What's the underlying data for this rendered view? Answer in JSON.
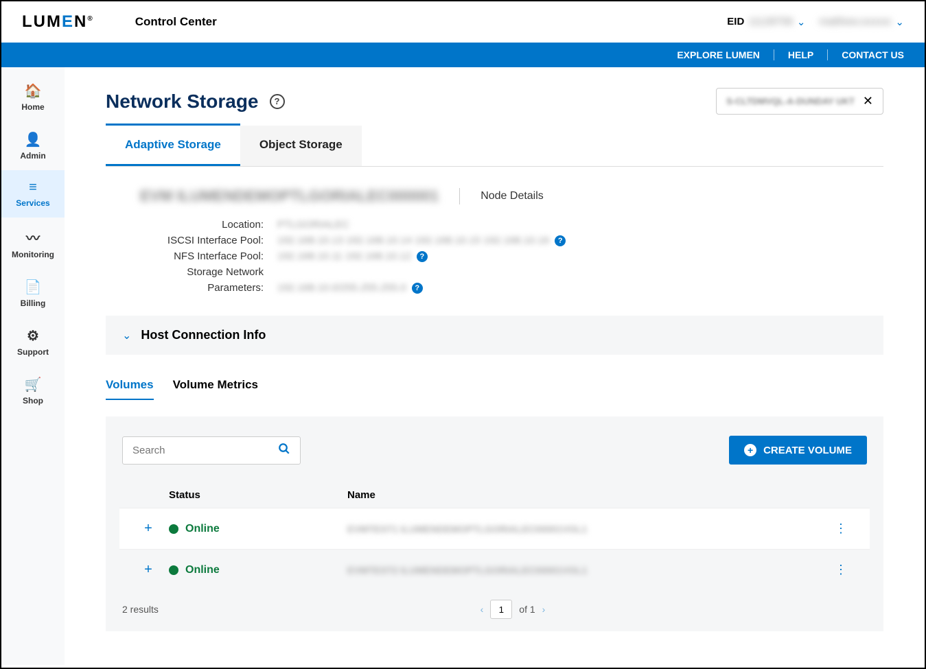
{
  "header": {
    "brand_prefix": "LUM",
    "brand_e": "E",
    "brand_suffix": "N",
    "reg": "®",
    "product": "Control Center",
    "eid_label": "EID",
    "eid_value": "11128758",
    "user_name": "matthew.xxxxxx"
  },
  "bluebar": {
    "explore": "EXPLORE LUMEN",
    "help": "HELP",
    "contact": "CONTACT US"
  },
  "sidebar": [
    {
      "icon": "🏠",
      "label": "Home"
    },
    {
      "icon": "👤",
      "label": "Admin"
    },
    {
      "icon": "☰",
      "label": "Services",
      "active": true
    },
    {
      "icon": "〰",
      "label": "Monitoring"
    },
    {
      "icon": "📄",
      "label": "Billing"
    },
    {
      "icon": "⚙",
      "label": "Support"
    },
    {
      "icon": "🛒",
      "label": "Shop"
    }
  ],
  "page": {
    "title": "Network Storage",
    "context_value": "S-CLTDMVQL-A-DUNDAY UKT"
  },
  "tabs": [
    {
      "label": "Adaptive Storage",
      "active": true
    },
    {
      "label": "Object Storage"
    }
  ],
  "node": {
    "name": "EVM ILUMENDEMOPTLGORIALEC000001",
    "details_link": "Node Details",
    "fields": {
      "location_label": "Location:",
      "location_value": "PTLGORIALEC",
      "iscsi_label": "ISCSI Interface Pool:",
      "iscsi_value": "192.168.10.13  192.168.10.14  192.168.10.15  192.168.10.16",
      "nfs_label": "NFS Interface Pool:",
      "nfs_value": "192.168.10.11  192.168.10.12",
      "storage_label_1": "Storage Network",
      "storage_label_2": "Parameters:",
      "storage_value": "192.168.10.0/255.255.255.0"
    }
  },
  "expand_panel": {
    "title": "Host Connection Info"
  },
  "inner_tabs": [
    {
      "label": "Volumes",
      "active": true
    },
    {
      "label": "Volume Metrics"
    }
  ],
  "volumes": {
    "search_placeholder": "Search",
    "create_label": "CREATE VOLUME",
    "col_status": "Status",
    "col_name": "Name",
    "rows": [
      {
        "status": "Online",
        "name": "EVMTEST1 ILUMENDEMOPTLGORIALEC00001VOL1"
      },
      {
        "status": "Online",
        "name": "EVMTEST2 ILUMENDEMOPTLGORIALEC00001VOL1"
      }
    ],
    "results_text": "2 results",
    "page_current": "1",
    "page_of": "of  1"
  }
}
